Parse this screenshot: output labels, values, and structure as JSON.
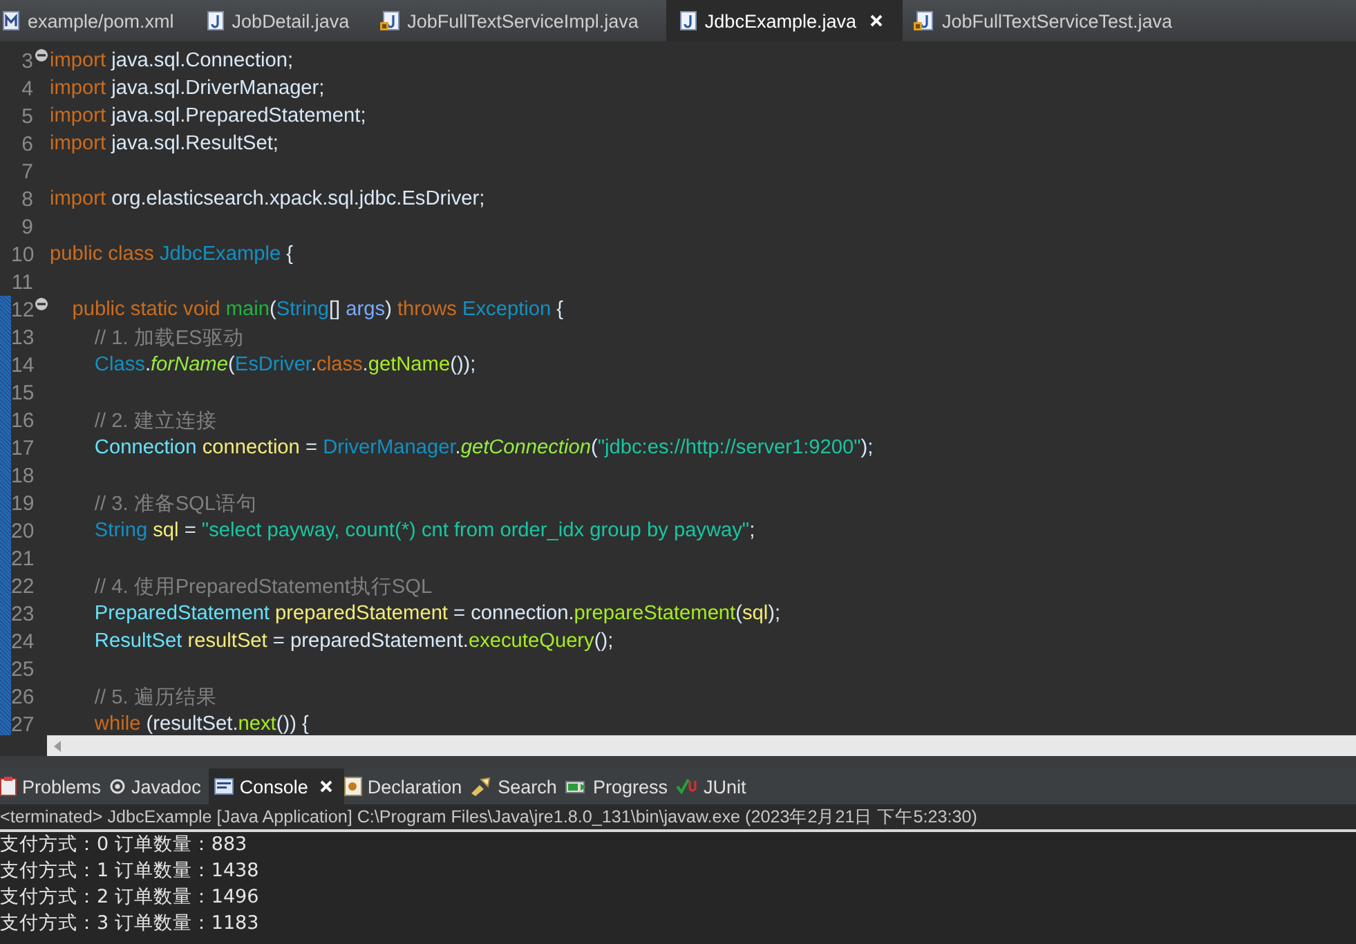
{
  "editor_tabs": [
    {
      "label": "example/pom.xml",
      "kind": "maven",
      "selected": false
    },
    {
      "label": "JobDetail.java",
      "kind": "java",
      "selected": false
    },
    {
      "label": "JobFullTextServiceImpl.java",
      "kind": "javalocked",
      "selected": false
    },
    {
      "label": "JdbcExample.java",
      "kind": "java",
      "selected": true
    },
    {
      "label": "JobFullTextServiceTest.java",
      "kind": "javalocked",
      "selected": false
    }
  ],
  "code_lines": [
    {
      "num": "3",
      "fold": true,
      "changed": false,
      "tokens": [
        {
          "text": "import ",
          "kind": "keyword"
        },
        {
          "text": "java.sql.Connection;",
          "kind": "plain"
        }
      ]
    },
    {
      "num": "4",
      "fold": false,
      "changed": false,
      "tokens": [
        {
          "text": "import ",
          "kind": "keyword"
        },
        {
          "text": "java.sql.DriverManager;",
          "kind": "plain"
        }
      ]
    },
    {
      "num": "5",
      "fold": false,
      "changed": false,
      "tokens": [
        {
          "text": "import ",
          "kind": "keyword"
        },
        {
          "text": "java.sql.PreparedStatement;",
          "kind": "plain"
        }
      ]
    },
    {
      "num": "6",
      "fold": false,
      "changed": false,
      "tokens": [
        {
          "text": "import ",
          "kind": "keyword"
        },
        {
          "text": "java.sql.ResultSet;",
          "kind": "plain"
        }
      ]
    },
    {
      "num": "7",
      "fold": false,
      "changed": false
    },
    {
      "num": "8",
      "fold": false,
      "changed": false,
      "tokens": [
        {
          "text": "import ",
          "kind": "keyword"
        },
        {
          "text": "org.elasticsearch.xpack.sql.jdbc.EsDriver;",
          "kind": "plain"
        }
      ]
    },
    {
      "num": "9",
      "fold": false,
      "changed": false
    },
    {
      "num": "10",
      "fold": false,
      "changed": false,
      "tokens": [
        {
          "text": "public class ",
          "kind": "keyword"
        },
        {
          "text": "JdbcExample",
          "kind": "type"
        },
        {
          "text": " {",
          "kind": "plain"
        }
      ]
    },
    {
      "num": "11",
      "fold": false,
      "changed": false
    },
    {
      "num": "12",
      "fold": true,
      "changed": true,
      "tokens": [
        {
          "text": "    public static void ",
          "kind": "keyword"
        },
        {
          "text": "main",
          "kind": "method"
        },
        {
          "text": "(",
          "kind": "plain"
        },
        {
          "text": "String",
          "kind": "type"
        },
        {
          "text": "[] ",
          "kind": "plain"
        },
        {
          "text": "args",
          "kind": "param"
        },
        {
          "text": ") ",
          "kind": "plain"
        },
        {
          "text": "throws ",
          "kind": "keyword"
        },
        {
          "text": "Exception",
          "kind": "type"
        },
        {
          "text": " {",
          "kind": "plain"
        }
      ]
    },
    {
      "num": "13",
      "fold": false,
      "changed": true,
      "tokens": [
        {
          "text": "        // 1. 加载ES驱动",
          "kind": "comment"
        }
      ]
    },
    {
      "num": "14",
      "fold": false,
      "changed": true,
      "tokens": [
        {
          "text": "        Class",
          "kind": "type"
        },
        {
          "text": ".",
          "kind": "plain"
        },
        {
          "text": "forName",
          "kind": "static"
        },
        {
          "text": "(",
          "kind": "plain"
        },
        {
          "text": "EsDriver",
          "kind": "type"
        },
        {
          "text": ".",
          "kind": "plain"
        },
        {
          "text": "class",
          "kind": "keyword"
        },
        {
          "text": ".",
          "kind": "plain"
        },
        {
          "text": "getName",
          "kind": "call"
        },
        {
          "text": "());",
          "kind": "plain"
        }
      ]
    },
    {
      "num": "15",
      "fold": false,
      "changed": true
    },
    {
      "num": "16",
      "fold": false,
      "changed": true,
      "tokens": [
        {
          "text": "        // 2. 建立连接",
          "kind": "comment"
        }
      ]
    },
    {
      "num": "17",
      "fold": false,
      "changed": true,
      "tokens": [
        {
          "text": "        Connection ",
          "kind": "local"
        },
        {
          "text": "connection",
          "kind": "var"
        },
        {
          "text": " = ",
          "kind": "plain"
        },
        {
          "text": "DriverManager",
          "kind": "type"
        },
        {
          "text": ".",
          "kind": "plain"
        },
        {
          "text": "getConnection",
          "kind": "static"
        },
        {
          "text": "(",
          "kind": "plain"
        },
        {
          "text": "\"jdbc:es://http://server1:9200\"",
          "kind": "string"
        },
        {
          "text": ");",
          "kind": "plain"
        }
      ]
    },
    {
      "num": "18",
      "fold": false,
      "changed": true
    },
    {
      "num": "19",
      "fold": false,
      "changed": true,
      "tokens": [
        {
          "text": "        // 3. 准备SQL语句",
          "kind": "comment"
        }
      ]
    },
    {
      "num": "20",
      "fold": false,
      "changed": true,
      "tokens": [
        {
          "text": "        String ",
          "kind": "type"
        },
        {
          "text": "sql",
          "kind": "var"
        },
        {
          "text": " = ",
          "kind": "plain"
        },
        {
          "text": "\"select payway, count(*) cnt from order_idx group by payway\"",
          "kind": "string"
        },
        {
          "text": ";",
          "kind": "plain"
        }
      ]
    },
    {
      "num": "21",
      "fold": false,
      "changed": true
    },
    {
      "num": "22",
      "fold": false,
      "changed": true,
      "tokens": [
        {
          "text": "        // 4. 使用PreparedStatement执行SQL",
          "kind": "comment"
        }
      ]
    },
    {
      "num": "23",
      "fold": false,
      "changed": true,
      "tokens": [
        {
          "text": "        PreparedStatement ",
          "kind": "local"
        },
        {
          "text": "preparedStatement",
          "kind": "var"
        },
        {
          "text": " = connection.",
          "kind": "plain"
        },
        {
          "text": "prepareStatement",
          "kind": "call"
        },
        {
          "text": "(",
          "kind": "plain"
        },
        {
          "text": "sql",
          "kind": "var"
        },
        {
          "text": ");",
          "kind": "plain"
        }
      ]
    },
    {
      "num": "24",
      "fold": false,
      "changed": true,
      "tokens": [
        {
          "text": "        ResultSet ",
          "kind": "local"
        },
        {
          "text": "resultSet",
          "kind": "var"
        },
        {
          "text": " = preparedStatement.",
          "kind": "plain"
        },
        {
          "text": "executeQuery",
          "kind": "call"
        },
        {
          "text": "();",
          "kind": "plain"
        }
      ]
    },
    {
      "num": "25",
      "fold": false,
      "changed": true
    },
    {
      "num": "26",
      "fold": false,
      "changed": true,
      "tokens": [
        {
          "text": "        // 5. 遍历结果",
          "kind": "comment"
        }
      ]
    },
    {
      "num": "27",
      "fold": false,
      "changed": true,
      "tokens": [
        {
          "text": "        while ",
          "kind": "keyword"
        },
        {
          "text": "(resultSet.",
          "kind": "plain"
        },
        {
          "text": "next",
          "kind": "call"
        },
        {
          "text": "()) {",
          "kind": "plain"
        }
      ]
    }
  ],
  "view_tabs": [
    {
      "label": "Problems",
      "kind": "problems",
      "selected": false
    },
    {
      "label": "Javadoc",
      "kind": "javadoc",
      "selected": false
    },
    {
      "label": "Console",
      "kind": "console",
      "selected": true
    },
    {
      "label": "Declaration",
      "kind": "declaration",
      "selected": false
    },
    {
      "label": "Search",
      "kind": "search",
      "selected": false
    },
    {
      "label": "Progress",
      "kind": "progress",
      "selected": false
    },
    {
      "label": "JUnit",
      "kind": "junit",
      "selected": false
    }
  ],
  "console": {
    "header": "<terminated> JdbcExample [Java Application] C:\\Program Files\\Java\\jre1.8.0_131\\bin\\javaw.exe (2023年2月21日 下午5:23:30)",
    "output": [
      "支付方式：0 订单数量：883",
      "支付方式：1 订单数量：1438",
      "支付方式：2 订单数量：1496",
      "支付方式：3 订单数量：1183"
    ]
  }
}
